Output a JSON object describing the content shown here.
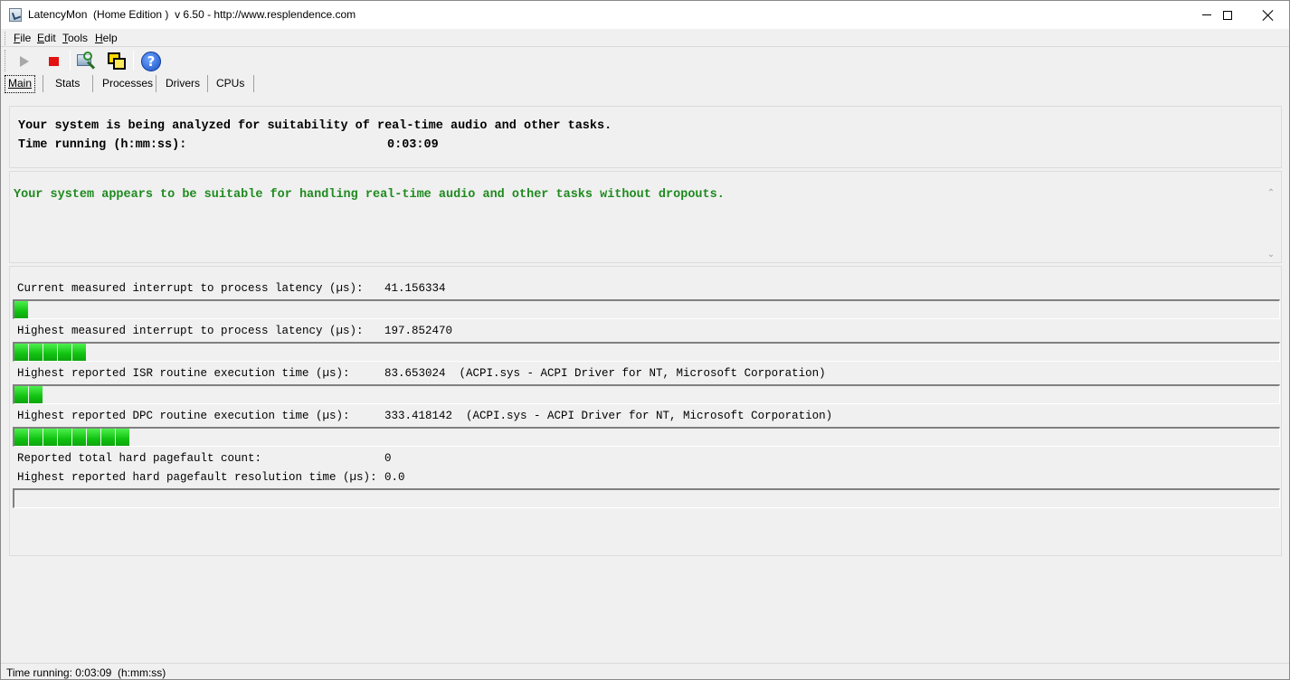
{
  "window": {
    "app_name": "LatencyMon",
    "title": "LatencyMon  (Home Edition )  v 6.50 - http://www.resplendence.com"
  },
  "menu": [
    {
      "label": "File",
      "accel": "F"
    },
    {
      "label": "Edit",
      "accel": "E"
    },
    {
      "label": "Tools",
      "accel": "T"
    },
    {
      "label": "Help",
      "accel": "H"
    }
  ],
  "toolbar": {
    "buttons": [
      {
        "name": "start-monitor",
        "icon": "play-icon",
        "enabled": false
      },
      {
        "name": "stop-monitor",
        "icon": "stop-icon",
        "color": "#e31010"
      },
      {
        "name": "analyze",
        "icon": "search-icon"
      },
      {
        "name": "windows",
        "icon": "windows-icon"
      },
      {
        "name": "help",
        "icon": "help-icon"
      }
    ]
  },
  "tabs": [
    {
      "label": "Main",
      "active": true
    },
    {
      "label": "Stats"
    },
    {
      "label": "Processes"
    },
    {
      "label": "Drivers"
    },
    {
      "label": "CPUs"
    }
  ],
  "status": {
    "analyzing": "Your system is being analyzed for suitability of real-time audio and other tasks.",
    "time_label": "Time running (h:mm:ss):",
    "time_value": "0:03:09"
  },
  "conclusion": {
    "text": "Your system appears to be suitable for handling real-time audio and other tasks without dropouts.",
    "color": "#1e8a1e"
  },
  "metrics": [
    {
      "label": "Current measured interrupt to process latency (µs):",
      "value": "41.156334",
      "segments": 1
    },
    {
      "label": "Highest measured interrupt to process latency (µs):",
      "value": "197.852470",
      "segments": 5
    },
    {
      "label": "Highest reported ISR routine execution time (µs):",
      "value": "83.653024  (ACPI.sys - ACPI Driver for NT, Microsoft Corporation)",
      "segments": 2
    },
    {
      "label": "Highest reported DPC routine execution time (µs):",
      "value": "333.418142  (ACPI.sys - ACPI Driver for NT, Microsoft Corporation)",
      "segments": 8
    }
  ],
  "pagefault": {
    "count_label": "Reported total hard pagefault count:",
    "count_value": "0",
    "time_label": "Highest reported hard pagefault resolution time (µs):",
    "time_value": "0.0",
    "segments": 0
  },
  "statusbar": {
    "text": "Time running: 0:03:09  (h:mm:ss)"
  },
  "colors": {
    "bar_green": "#11c211",
    "window_bg": "#f0f0f0"
  }
}
